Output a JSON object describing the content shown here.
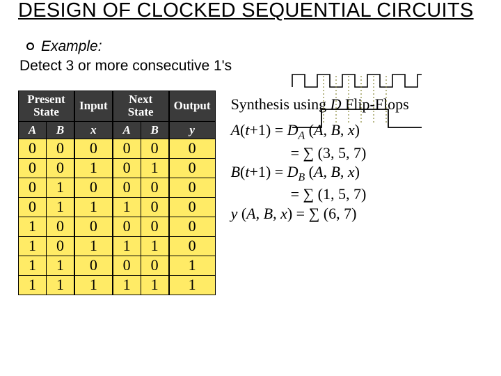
{
  "title": "DESIGN OF CLOCKED SEQUENTIAL CIRCUITS",
  "example_label": "Example:",
  "example_desc": "Detect 3 or more consecutive 1's",
  "table": {
    "header": {
      "present_state": "Present\nState",
      "input": "Input",
      "next_state": "Next\nState",
      "output": "Output"
    },
    "sub": {
      "A1": "A",
      "B1": "B",
      "x": "x",
      "A2": "A",
      "B2": "B",
      "y": "y"
    },
    "rows": [
      [
        "0",
        "0",
        "0",
        "0",
        "0",
        "0"
      ],
      [
        "0",
        "0",
        "1",
        "0",
        "1",
        "0"
      ],
      [
        "0",
        "1",
        "0",
        "0",
        "0",
        "0"
      ],
      [
        "0",
        "1",
        "1",
        "1",
        "0",
        "0"
      ],
      [
        "1",
        "0",
        "0",
        "0",
        "0",
        "0"
      ],
      [
        "1",
        "0",
        "1",
        "1",
        "1",
        "0"
      ],
      [
        "1",
        "1",
        "0",
        "0",
        "0",
        "1"
      ],
      [
        "1",
        "1",
        "1",
        "1",
        "1",
        "1"
      ]
    ]
  },
  "synthesis_label_pre": "Synthesis using ",
  "synthesis_label_D": "D",
  "synthesis_label_post": " Flip-Flops",
  "eq": {
    "A_lhs_var": "A",
    "B_lhs_var": "B",
    "t1": "t",
    "plus1": "+1) = ",
    "paren_open": "(",
    "DA": "D",
    "DA_sub": "A",
    "DB": "D",
    "DB_sub": "B",
    "args_open": " (",
    "A": "A",
    "B": "B",
    "x": "x",
    "comma": ", ",
    "args_close": ")",
    "sum": "∑",
    "eq_sum": "= ",
    "A_terms": " (3, 5, 7)",
    "B_terms": " (1, 5, 7)",
    "y_var": "y",
    "y_args": " (",
    "y_terms_eq": ") = ",
    "y_terms": " (6, 7)"
  },
  "chart_data": {
    "type": "table",
    "title": "State table: detect 3+ consecutive 1's",
    "columns": [
      "Present A",
      "Present B",
      "Input x",
      "Next A",
      "Next B",
      "Output y"
    ],
    "rows": [
      [
        0,
        0,
        0,
        0,
        0,
        0
      ],
      [
        0,
        0,
        1,
        0,
        1,
        0
      ],
      [
        0,
        1,
        0,
        0,
        0,
        0
      ],
      [
        0,
        1,
        1,
        1,
        0,
        0
      ],
      [
        1,
        0,
        0,
        0,
        0,
        0
      ],
      [
        1,
        0,
        1,
        1,
        1,
        0
      ],
      [
        1,
        1,
        0,
        0,
        0,
        1
      ],
      [
        1,
        1,
        1,
        1,
        1,
        1
      ]
    ]
  }
}
